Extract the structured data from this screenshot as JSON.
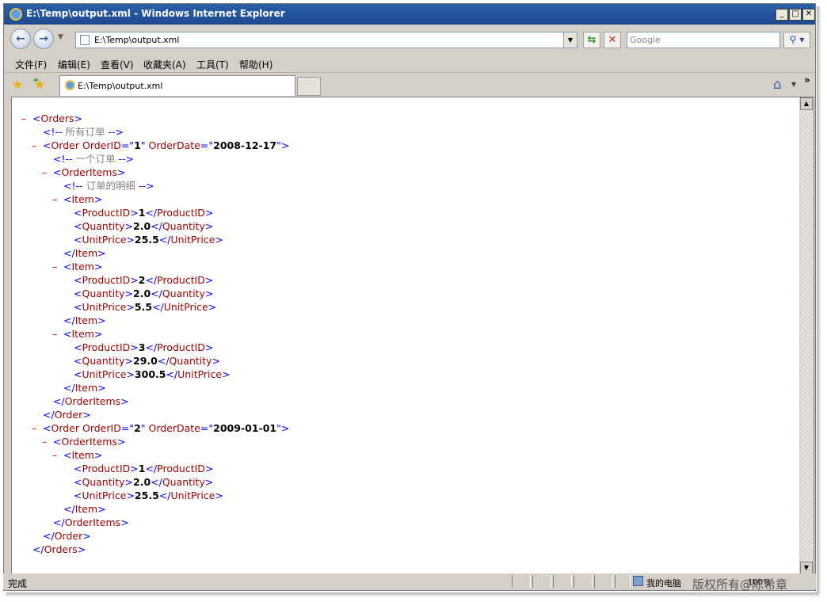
{
  "window": {
    "title": "E:\\Temp\\output.xml - Windows Internet Explorer"
  },
  "caption_buttons": {
    "minimize": "_",
    "maximize": "□",
    "close": "✕"
  },
  "address_bar": {
    "url": "E:\\Temp\\output.xml",
    "icon": "page-icon"
  },
  "search": {
    "placeholder": "Google"
  },
  "menu": [
    {
      "label": "文件(F)"
    },
    {
      "label": "编辑(E)"
    },
    {
      "label": "查看(V)"
    },
    {
      "label": "收藏夹(A)"
    },
    {
      "label": "工具(T)"
    },
    {
      "label": "帮助(H)"
    }
  ],
  "tab": {
    "label": "E:\\Temp\\output.xml"
  },
  "xml_lines": [
    {
      "m": "–",
      "parts": [
        [
          "b",
          "<"
        ],
        [
          "t",
          "Orders"
        ],
        [
          "b",
          ">"
        ]
      ]
    },
    {
      "m": "",
      "parts": [
        [
          "b",
          "<!-- "
        ],
        [
          "c",
          "所有订单 "
        ],
        [
          "b",
          " -->"
        ]
      ]
    },
    {
      "m": "–",
      "parts": [
        [
          "b",
          "<"
        ],
        [
          "t",
          "Order OrderID"
        ],
        [
          "b",
          "=\""
        ],
        [
          "v",
          "1"
        ],
        [
          "b",
          "\" "
        ],
        [
          "t",
          "OrderDate"
        ],
        [
          "b",
          "=\""
        ],
        [
          "v",
          "2008-12-17"
        ],
        [
          "b",
          "\">"
        ]
      ]
    },
    {
      "m": "",
      "parts": [
        [
          "b",
          "<!-- "
        ],
        [
          "c",
          "一个订单 "
        ],
        [
          "b",
          " -->"
        ]
      ]
    },
    {
      "m": "–",
      "parts": [
        [
          "b",
          "<"
        ],
        [
          "t",
          "OrderItems"
        ],
        [
          "b",
          ">"
        ]
      ]
    },
    {
      "m": "",
      "parts": [
        [
          "b",
          "<!-- "
        ],
        [
          "c",
          "订单的明细 "
        ],
        [
          "b",
          " -->"
        ]
      ]
    },
    {
      "m": "–",
      "parts": [
        [
          "b",
          "<"
        ],
        [
          "t",
          "Item"
        ],
        [
          "b",
          ">"
        ]
      ]
    },
    {
      "m": "",
      "parts": [
        [
          "b",
          "<"
        ],
        [
          "t",
          "ProductID"
        ],
        [
          "b",
          ">"
        ],
        [
          "v",
          "1"
        ],
        [
          "b",
          "</"
        ],
        [
          "t",
          "ProductID"
        ],
        [
          "b",
          ">"
        ]
      ]
    },
    {
      "m": "",
      "parts": [
        [
          "b",
          "<"
        ],
        [
          "t",
          "Quantity"
        ],
        [
          "b",
          ">"
        ],
        [
          "v",
          "2.0"
        ],
        [
          "b",
          "</"
        ],
        [
          "t",
          "Quantity"
        ],
        [
          "b",
          ">"
        ]
      ]
    },
    {
      "m": "",
      "parts": [
        [
          "b",
          "<"
        ],
        [
          "t",
          "UnitPrice"
        ],
        [
          "b",
          ">"
        ],
        [
          "v",
          "25.5"
        ],
        [
          "b",
          "</"
        ],
        [
          "t",
          "UnitPrice"
        ],
        [
          "b",
          ">"
        ]
      ]
    },
    {
      "m": "",
      "parts": [
        [
          "b",
          "</"
        ],
        [
          "t",
          "Item"
        ],
        [
          "b",
          ">"
        ]
      ]
    },
    {
      "m": "–",
      "parts": [
        [
          "b",
          "<"
        ],
        [
          "t",
          "Item"
        ],
        [
          "b",
          ">"
        ]
      ]
    },
    {
      "m": "",
      "parts": [
        [
          "b",
          "<"
        ],
        [
          "t",
          "ProductID"
        ],
        [
          "b",
          ">"
        ],
        [
          "v",
          "2"
        ],
        [
          "b",
          "</"
        ],
        [
          "t",
          "ProductID"
        ],
        [
          "b",
          ">"
        ]
      ]
    },
    {
      "m": "",
      "parts": [
        [
          "b",
          "<"
        ],
        [
          "t",
          "Quantity"
        ],
        [
          "b",
          ">"
        ],
        [
          "v",
          "2.0"
        ],
        [
          "b",
          "</"
        ],
        [
          "t",
          "Quantity"
        ],
        [
          "b",
          ">"
        ]
      ]
    },
    {
      "m": "",
      "parts": [
        [
          "b",
          "<"
        ],
        [
          "t",
          "UnitPrice"
        ],
        [
          "b",
          ">"
        ],
        [
          "v",
          "5.5"
        ],
        [
          "b",
          "</"
        ],
        [
          "t",
          "UnitPrice"
        ],
        [
          "b",
          ">"
        ]
      ]
    },
    {
      "m": "",
      "parts": [
        [
          "b",
          "</"
        ],
        [
          "t",
          "Item"
        ],
        [
          "b",
          ">"
        ]
      ]
    },
    {
      "m": "–",
      "parts": [
        [
          "b",
          "<"
        ],
        [
          "t",
          "Item"
        ],
        [
          "b",
          ">"
        ]
      ]
    },
    {
      "m": "",
      "parts": [
        [
          "b",
          "<"
        ],
        [
          "t",
          "ProductID"
        ],
        [
          "b",
          ">"
        ],
        [
          "v",
          "3"
        ],
        [
          "b",
          "</"
        ],
        [
          "t",
          "ProductID"
        ],
        [
          "b",
          ">"
        ]
      ]
    },
    {
      "m": "",
      "parts": [
        [
          "b",
          "<"
        ],
        [
          "t",
          "Quantity"
        ],
        [
          "b",
          ">"
        ],
        [
          "v",
          "29.0"
        ],
        [
          "b",
          "</"
        ],
        [
          "t",
          "Quantity"
        ],
        [
          "b",
          ">"
        ]
      ]
    },
    {
      "m": "",
      "parts": [
        [
          "b",
          "<"
        ],
        [
          "t",
          "UnitPrice"
        ],
        [
          "b",
          ">"
        ],
        [
          "v",
          "300.5"
        ],
        [
          "b",
          "</"
        ],
        [
          "t",
          "UnitPrice"
        ],
        [
          "b",
          ">"
        ]
      ]
    },
    {
      "m": "",
      "parts": [
        [
          "b",
          "</"
        ],
        [
          "t",
          "Item"
        ],
        [
          "b",
          ">"
        ]
      ]
    },
    {
      "m": "",
      "parts": [
        [
          "b",
          "</"
        ],
        [
          "t",
          "OrderItems"
        ],
        [
          "b",
          ">"
        ]
      ]
    },
    {
      "m": "",
      "parts": [
        [
          "b",
          "</"
        ],
        [
          "t",
          "Order"
        ],
        [
          "b",
          ">"
        ]
      ]
    },
    {
      "m": "–",
      "parts": [
        [
          "b",
          "<"
        ],
        [
          "t",
          "Order OrderID"
        ],
        [
          "b",
          "=\""
        ],
        [
          "v",
          "2"
        ],
        [
          "b",
          "\" "
        ],
        [
          "t",
          "OrderDate"
        ],
        [
          "b",
          "=\""
        ],
        [
          "v",
          "2009-01-01"
        ],
        [
          "b",
          "\">"
        ]
      ]
    },
    {
      "m": "–",
      "parts": [
        [
          "b",
          "<"
        ],
        [
          "t",
          "OrderItems"
        ],
        [
          "b",
          ">"
        ]
      ]
    },
    {
      "m": "–",
      "parts": [
        [
          "b",
          "<"
        ],
        [
          "t",
          "Item"
        ],
        [
          "b",
          ">"
        ]
      ]
    },
    {
      "m": "",
      "parts": [
        [
          "b",
          "<"
        ],
        [
          "t",
          "ProductID"
        ],
        [
          "b",
          ">"
        ],
        [
          "v",
          "1"
        ],
        [
          "b",
          "</"
        ],
        [
          "t",
          "ProductID"
        ],
        [
          "b",
          ">"
        ]
      ]
    },
    {
      "m": "",
      "parts": [
        [
          "b",
          "<"
        ],
        [
          "t",
          "Quantity"
        ],
        [
          "b",
          ">"
        ],
        [
          "v",
          "2.0"
        ],
        [
          "b",
          "</"
        ],
        [
          "t",
          "Quantity"
        ],
        [
          "b",
          ">"
        ]
      ]
    },
    {
      "m": "",
      "parts": [
        [
          "b",
          "<"
        ],
        [
          "t",
          "UnitPrice"
        ],
        [
          "b",
          ">"
        ],
        [
          "v",
          "25.5"
        ],
        [
          "b",
          "</"
        ],
        [
          "t",
          "UnitPrice"
        ],
        [
          "b",
          ">"
        ]
      ]
    },
    {
      "m": "",
      "parts": [
        [
          "b",
          "</"
        ],
        [
          "t",
          "Item"
        ],
        [
          "b",
          ">"
        ]
      ]
    },
    {
      "m": "",
      "parts": [
        [
          "b",
          "</"
        ],
        [
          "t",
          "OrderItems"
        ],
        [
          "b",
          ">"
        ]
      ]
    },
    {
      "m": "",
      "parts": [
        [
          "b",
          "</"
        ],
        [
          "t",
          "Order"
        ],
        [
          "b",
          ">"
        ]
      ]
    },
    {
      "m": "",
      "parts": [
        [
          "b",
          "</"
        ],
        [
          "t",
          "Orders"
        ],
        [
          "b",
          ">"
        ]
      ]
    }
  ],
  "status": {
    "text": "完成",
    "zone": "我的电脑",
    "zoom": "100%"
  },
  "watermark": "版权所有@陈希章",
  "colors": {
    "markup_bracket": "#0000ff",
    "tag_name": "#990000",
    "value": "#000000",
    "comment": "#808080",
    "collapse_minus": "#ff0000",
    "titlebar": "#2b5fa9"
  }
}
